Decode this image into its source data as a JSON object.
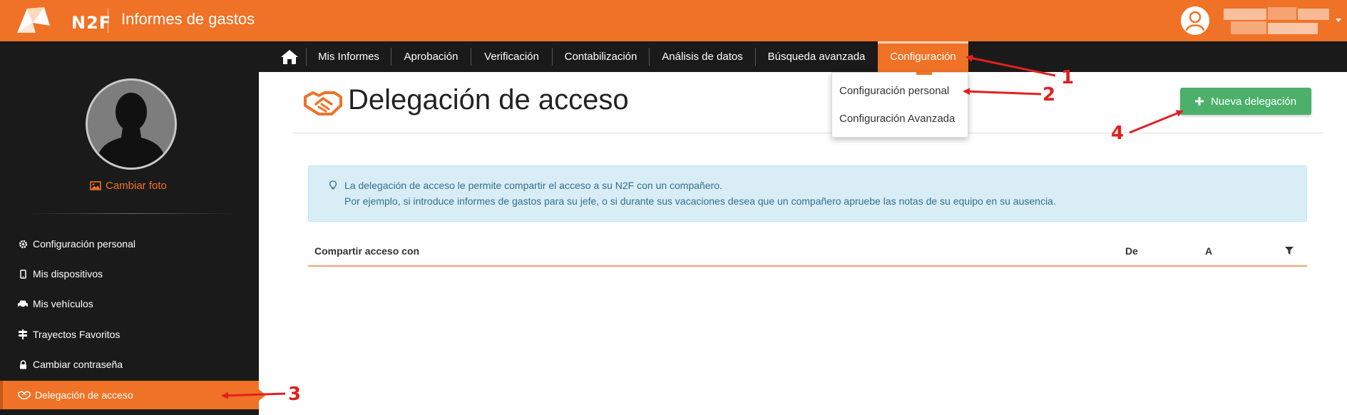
{
  "app": {
    "logo_text": "N2F",
    "title": "Informes de gastos"
  },
  "nav": {
    "items": [
      {
        "label": "Mis Informes"
      },
      {
        "label": "Aprobación"
      },
      {
        "label": "Verificación"
      },
      {
        "label": "Contabilización"
      },
      {
        "label": "Análisis de datos"
      },
      {
        "label": "Búsqueda avanzada"
      },
      {
        "label": "Configuración"
      }
    ],
    "active_index": 6
  },
  "dropdown": {
    "items": [
      {
        "label": "Configuración personal"
      },
      {
        "label": "Configuración Avanzada"
      }
    ]
  },
  "sidebar": {
    "change_photo": "Cambiar foto",
    "items": [
      {
        "label": "Configuración personal",
        "icon": "gear-icon"
      },
      {
        "label": "Mis dispositivos",
        "icon": "mobile-icon"
      },
      {
        "label": "Mis vehículos",
        "icon": "car-icon"
      },
      {
        "label": "Trayectos Favoritos",
        "icon": "signpost-icon"
      },
      {
        "label": "Cambiar contraseña",
        "icon": "lock-icon"
      },
      {
        "label": "Delegación de acceso",
        "icon": "handshake-icon"
      }
    ],
    "active_index": 5
  },
  "main": {
    "title": "Delegación de acceso",
    "new_button": "Nueva delegación",
    "info": {
      "line1": "La delegación de acceso le permite compartir el acceso a su N2F con un compañero.",
      "line2": "Por ejemplo, si introduce informes de gastos para su jefe, o si durante sus vacaciones desea que un compañero apruebe las notas de su equipo en su ausencia."
    },
    "table": {
      "columns": [
        "Compartir acceso con",
        "De",
        "A"
      ]
    }
  },
  "annotations": [
    "1",
    "2",
    "3",
    "4"
  ],
  "colors": {
    "brand": "#f07226",
    "nav_bg": "#1a1a1a",
    "success": "#4cb06b",
    "info_bg": "#d9edf7",
    "annotation": "#e02020"
  }
}
